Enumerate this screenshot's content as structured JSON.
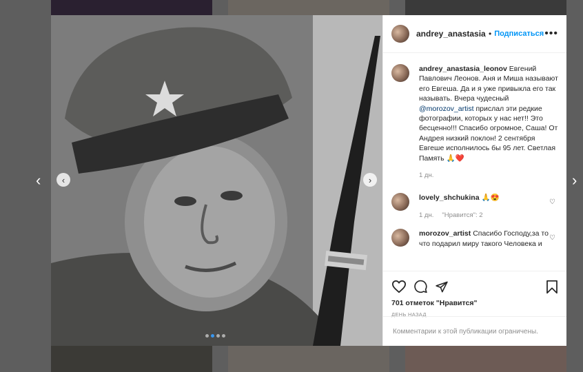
{
  "post": {
    "username": "andrey_anastasia_leonov",
    "username_short": "andrey_anastasia_l",
    "follow_label": "Подписаться",
    "more_label": "•••",
    "caption_text": "Евгений Павлович Леонов. Аня и Миша называют его Евгеша. Да и я уже привыкла его так называть. Вчера чудесный",
    "caption_mention": "@morozov_artist",
    "caption_text2": "прислал эти редкие фотографии, которых у нас нет!! Это бесценно!!! Спасибо огромное, Саша! От Андрея низкий поклон! 2 сентября Евгеше исполнилось бы 95 лет. Светлая Память",
    "caption_emoji": "🙏❤️",
    "caption_time": "1 дн.",
    "likes": "701 отметок \"Нравится\"",
    "time_ago": "ДЕНЬ НАЗАД",
    "comments_disabled": "Комментарии к этой публикации ограничены."
  },
  "comments": [
    {
      "username": "lovely_shchukina",
      "text": "🙏😍",
      "time": "1 дн.",
      "likes": "\"Нравится\": 2"
    },
    {
      "username": "morozov_artist",
      "text": "Спасибо Господу,за то что подарил миру такого Человека и"
    }
  ],
  "icons": {
    "star": "star-icon",
    "heart": "heart-icon",
    "comment": "comment-icon",
    "share": "share-icon",
    "bookmark": "bookmark-icon"
  },
  "colors": {
    "link": "#0095f6",
    "mention": "#00376b",
    "muted": "#8e8e8e"
  }
}
